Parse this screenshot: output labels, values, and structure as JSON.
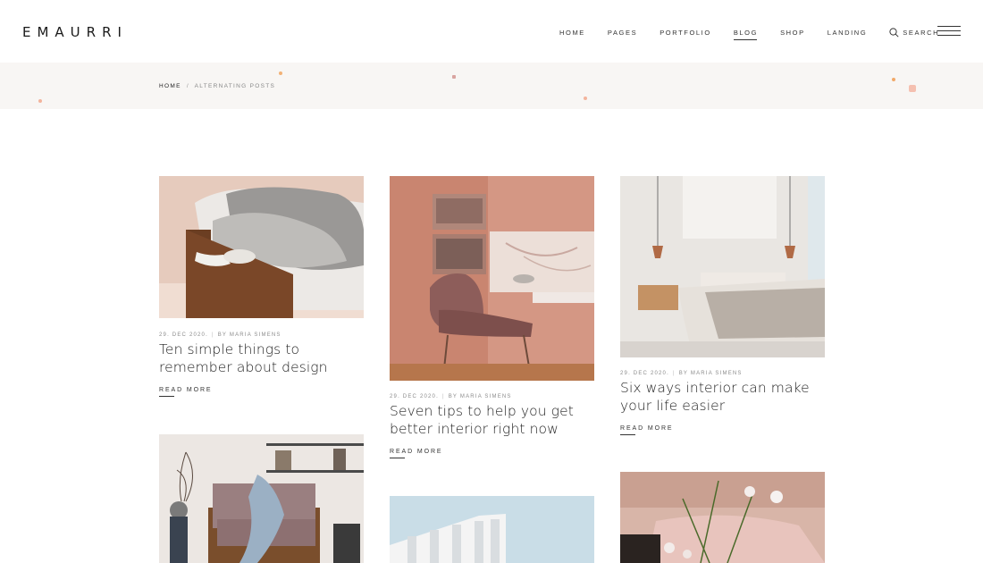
{
  "brand": {
    "logo": "EMAURRI"
  },
  "nav": {
    "items": [
      {
        "label": "HOME",
        "active": false
      },
      {
        "label": "PAGES",
        "active": false
      },
      {
        "label": "PORTFOLIO",
        "active": false
      },
      {
        "label": "BLOG",
        "active": true
      },
      {
        "label": "SHOP",
        "active": false
      },
      {
        "label": "LANDING",
        "active": false
      }
    ],
    "search_label": "SEARCH"
  },
  "breadcrumb": {
    "home": "HOME",
    "separator": "/",
    "current": "ALTERNATING POSTS"
  },
  "posts": [
    {
      "date": "29. DEC 2020.",
      "author": "BY MARIA SIMENS",
      "title": "Ten simple things to remember about design",
      "read_more": "READ MORE"
    },
    {
      "date": "29. DEC 2020.",
      "author": "BY MARIA SIMENS",
      "title": "Seven tips to help you get better interior right now",
      "read_more": "READ MORE"
    },
    {
      "date": "29. DEC 2020.",
      "author": "BY MARIA SIMENS",
      "title": "Six ways interior can make your life easier",
      "read_more": "READ MORE"
    }
  ],
  "colors": {
    "band": "#f8f6f4",
    "accent_dots": "#f3b49c",
    "text": "#1e1e1e",
    "meta": "#8c8c8c"
  }
}
